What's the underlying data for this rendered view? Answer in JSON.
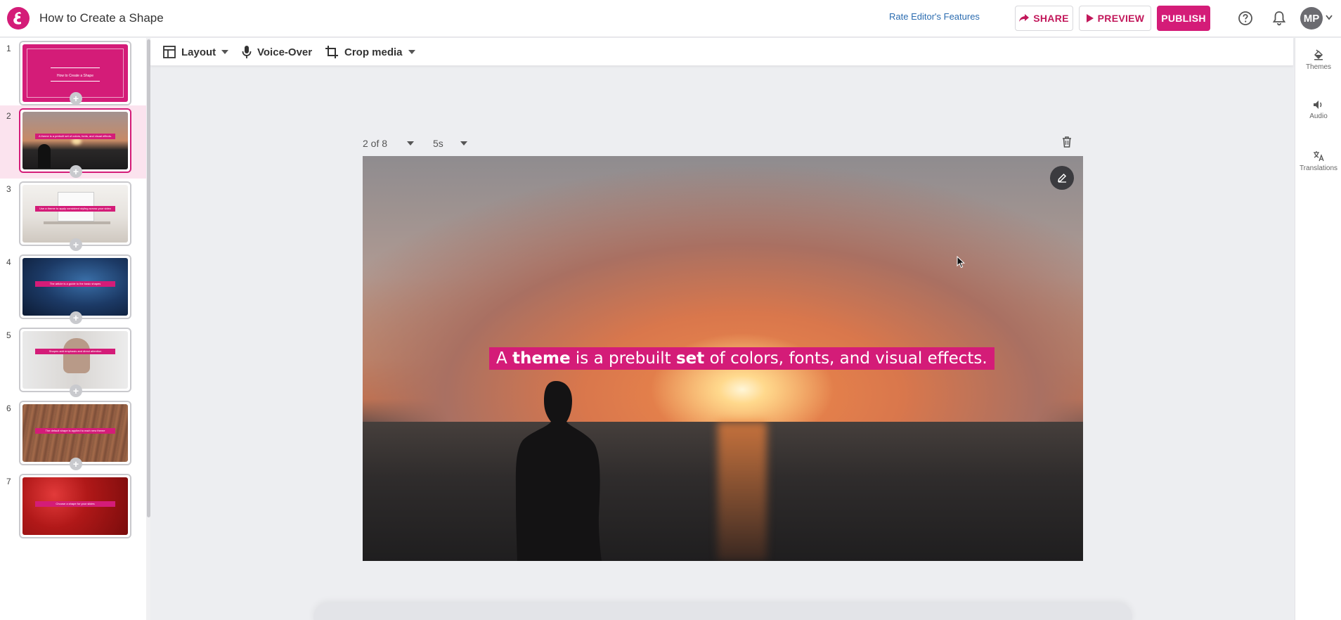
{
  "header": {
    "title": "How to Create a Shape",
    "rate_link": "Rate Editor's Features",
    "share_label": "SHARE",
    "preview_label": "PREVIEW",
    "publish_label": "PUBLISH",
    "avatar_initials": "MP"
  },
  "toolbar": {
    "layout_label": "Layout",
    "voiceover_label": "Voice-Over",
    "crop_label": "Crop media"
  },
  "right_sidebar": {
    "items": [
      {
        "label": "Themes",
        "icon": "paint-bucket-icon"
      },
      {
        "label": "Audio",
        "icon": "speaker-icon"
      },
      {
        "label": "Translations",
        "icon": "translate-icon"
      }
    ]
  },
  "slides": {
    "items": [
      {
        "number": "1",
        "caption": "How to Create a Shape",
        "bg": "#d41c78"
      },
      {
        "number": "2",
        "caption": "A theme is a prebuilt set of colors, fonts, and visual effects.",
        "bg": "sunset"
      },
      {
        "number": "3",
        "caption": "Use a theme to apply consistent styling across your video",
        "bg": "office"
      },
      {
        "number": "4",
        "caption": "The article is a guide to the basic shapes",
        "bg": "space"
      },
      {
        "number": "5",
        "caption": "Shapes add emphasis and direct attention",
        "bg": "portrait"
      },
      {
        "number": "6",
        "caption": "The default shape is applied to each new theme",
        "bg": "rust"
      },
      {
        "number": "7",
        "caption": "Choose a shape for your slides",
        "bg": "red"
      }
    ],
    "active_index": 1
  },
  "canvas": {
    "slide_position": "2 of 8",
    "duration": "5s",
    "caption_parts": {
      "p1": "A ",
      "b1": "theme",
      "p2": " is a prebuilt ",
      "b2": "set",
      "p3": " of colors, fonts, and visual effects."
    }
  },
  "colors": {
    "brand": "#d41c78",
    "link": "#2b6cb0"
  }
}
